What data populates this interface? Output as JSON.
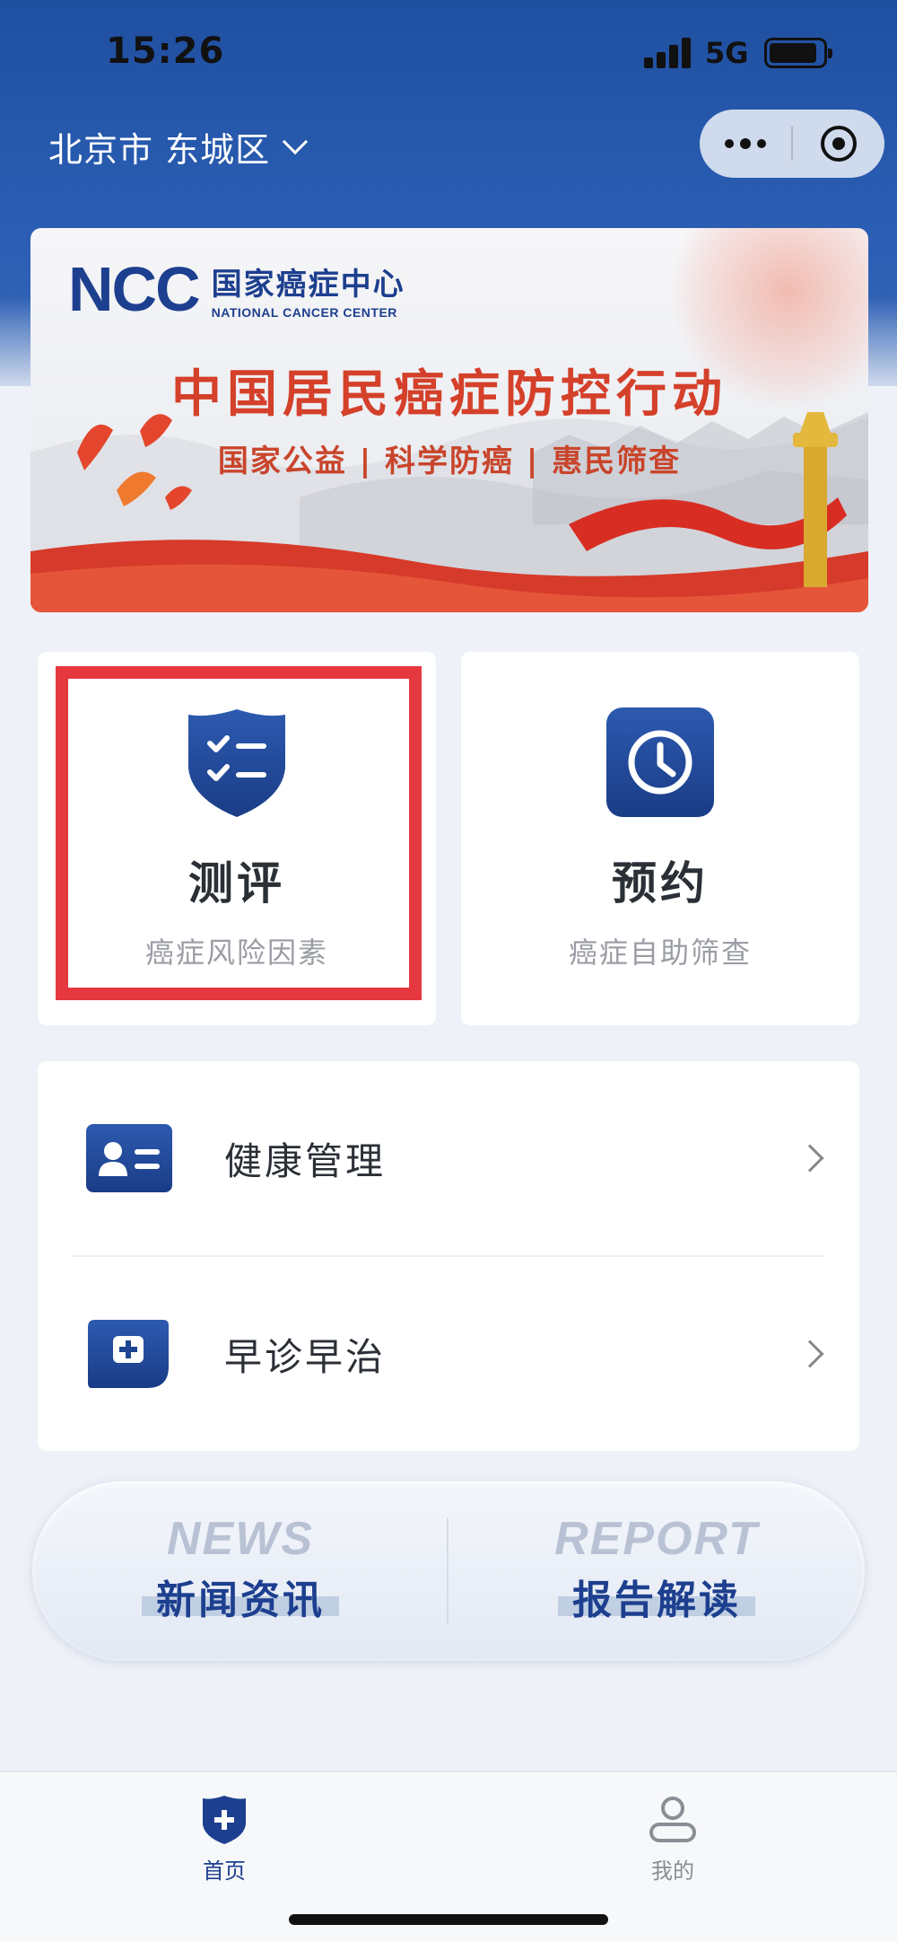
{
  "status_bar": {
    "time": "15:26",
    "network": "5G"
  },
  "header": {
    "location": "北京市 东城区"
  },
  "banner": {
    "logo_letters": "NCC",
    "logo_cn": "国家癌症中心",
    "logo_en": "NATIONAL CANCER CENTER",
    "title": "中国居民癌症防控行动",
    "subtitle": "国家公益 | 科学防癌 | 惠民筛查"
  },
  "features": [
    {
      "title": "测评",
      "subtitle": "癌症风险因素",
      "icon": "shield-checklist-icon"
    },
    {
      "title": "预约",
      "subtitle": "癌症自助筛查",
      "icon": "clock-icon"
    }
  ],
  "menu": [
    {
      "label": "健康管理",
      "icon": "id-card-icon"
    },
    {
      "label": "早诊早治",
      "icon": "medical-kit-icon"
    }
  ],
  "quick_links": [
    {
      "en": "NEWS",
      "cn": "新闻资讯"
    },
    {
      "en": "REPORT",
      "cn": "报告解读"
    }
  ],
  "tabbar": [
    {
      "label": "首页",
      "icon": "home-shield-icon",
      "active": true
    },
    {
      "label": "我的",
      "icon": "user-icon",
      "active": false
    }
  ],
  "colors": {
    "brand": "#1d3f8f",
    "header": "#2a5db2",
    "highlight": "#e5383f",
    "banner_red": "#d4402a"
  }
}
